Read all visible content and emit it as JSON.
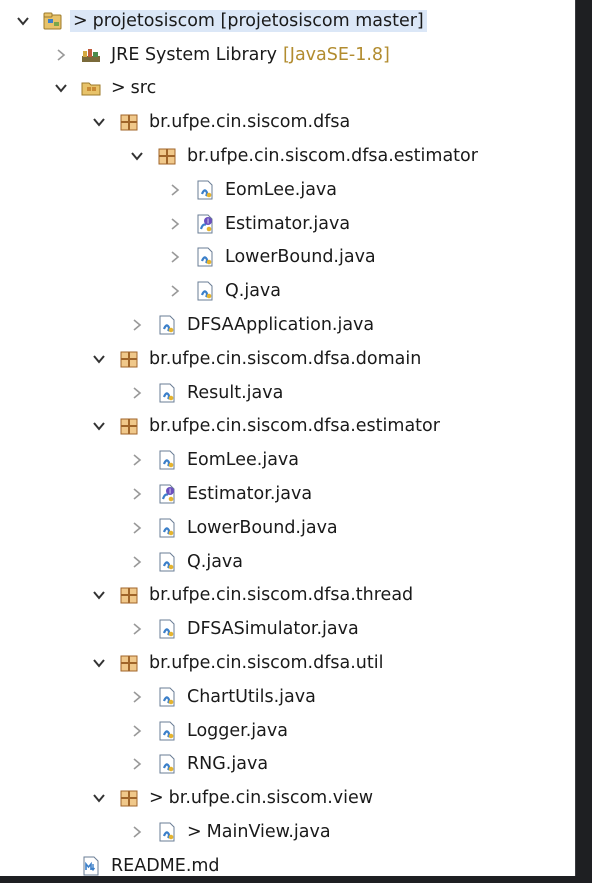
{
  "colors": {
    "background": "#1e1f22",
    "panel": "#ffffff",
    "selection": "#dbe7f7",
    "text": "#1a1a1a",
    "decoration_suffix": "#b28c2f",
    "package_icon": "#c98a35",
    "java_icon": "#3b7fc9"
  },
  "tree": [
    {
      "depth": 0,
      "arrow": "expanded",
      "icon": "project-icon",
      "deco": ">",
      "label": "projetosiscom [projetosiscom master]",
      "selected": true
    },
    {
      "depth": 1,
      "arrow": "collapsed",
      "icon": "library-icon",
      "label": "JRE System Library",
      "suffix": "[JavaSE-1.8]"
    },
    {
      "depth": 1,
      "arrow": "expanded",
      "icon": "source-folder-icon",
      "deco": ">",
      "label": "src"
    },
    {
      "depth": 2,
      "arrow": "expanded",
      "icon": "package-icon",
      "label": "br.ufpe.cin.siscom.dfsa"
    },
    {
      "depth": 3,
      "arrow": "expanded",
      "icon": "package-icon",
      "label": "br.ufpe.cin.siscom.dfsa.estimator"
    },
    {
      "depth": 4,
      "arrow": "collapsed",
      "icon": "java-file-icon",
      "label": "EomLee.java"
    },
    {
      "depth": 4,
      "arrow": "collapsed",
      "icon": "java-interface-icon",
      "label": "Estimator.java"
    },
    {
      "depth": 4,
      "arrow": "collapsed",
      "icon": "java-file-icon",
      "label": "LowerBound.java"
    },
    {
      "depth": 4,
      "arrow": "collapsed",
      "icon": "java-file-icon",
      "label": "Q.java"
    },
    {
      "depth": 3,
      "arrow": "collapsed",
      "icon": "java-file-icon",
      "label": "DFSAApplication.java"
    },
    {
      "depth": 2,
      "arrow": "expanded",
      "icon": "package-icon",
      "label": "br.ufpe.cin.siscom.dfsa.domain"
    },
    {
      "depth": 3,
      "arrow": "collapsed",
      "icon": "java-file-icon",
      "label": "Result.java"
    },
    {
      "depth": 2,
      "arrow": "expanded",
      "icon": "package-icon",
      "label": "br.ufpe.cin.siscom.dfsa.estimator"
    },
    {
      "depth": 3,
      "arrow": "collapsed",
      "icon": "java-file-icon",
      "label": "EomLee.java"
    },
    {
      "depth": 3,
      "arrow": "collapsed",
      "icon": "java-interface-icon",
      "label": "Estimator.java"
    },
    {
      "depth": 3,
      "arrow": "collapsed",
      "icon": "java-file-icon",
      "label": "LowerBound.java"
    },
    {
      "depth": 3,
      "arrow": "collapsed",
      "icon": "java-file-icon",
      "label": "Q.java"
    },
    {
      "depth": 2,
      "arrow": "expanded",
      "icon": "package-icon",
      "label": "br.ufpe.cin.siscom.dfsa.thread"
    },
    {
      "depth": 3,
      "arrow": "collapsed",
      "icon": "java-file-icon",
      "label": "DFSASimulator.java"
    },
    {
      "depth": 2,
      "arrow": "expanded",
      "icon": "package-icon",
      "label": "br.ufpe.cin.siscom.dfsa.util"
    },
    {
      "depth": 3,
      "arrow": "collapsed",
      "icon": "java-file-icon",
      "label": "ChartUtils.java"
    },
    {
      "depth": 3,
      "arrow": "collapsed",
      "icon": "java-file-icon",
      "label": "Logger.java"
    },
    {
      "depth": 3,
      "arrow": "collapsed",
      "icon": "java-file-icon",
      "label": "RNG.java"
    },
    {
      "depth": 2,
      "arrow": "expanded",
      "icon": "package-icon",
      "deco": ">",
      "label": "br.ufpe.cin.siscom.view"
    },
    {
      "depth": 3,
      "arrow": "collapsed",
      "icon": "java-file-icon",
      "deco": ">",
      "label": "MainView.java"
    },
    {
      "depth": 1,
      "arrow": "none",
      "icon": "markdown-file-icon",
      "label": "README.md"
    }
  ]
}
